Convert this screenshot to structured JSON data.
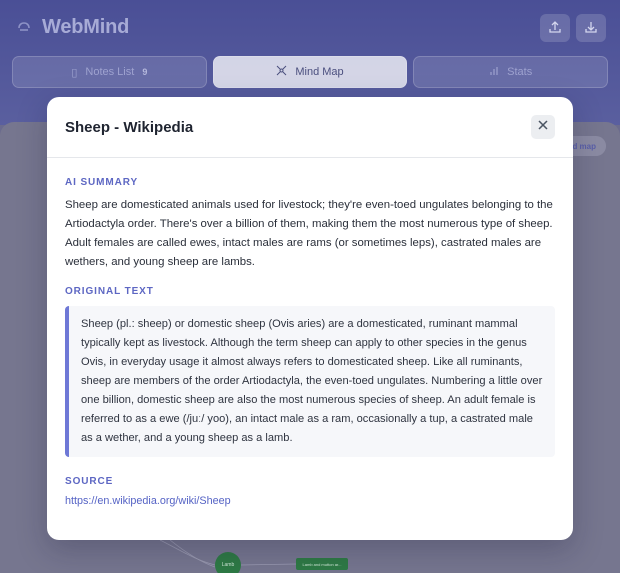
{
  "app": {
    "title": "WebMind"
  },
  "tabs": [
    {
      "label": "Notes List",
      "badge": "9",
      "icon": "notes-icon"
    },
    {
      "label": "Mind Map",
      "icon": "mind-map-icon"
    },
    {
      "label": "Stats",
      "icon": "bar-chart-icon"
    }
  ],
  "canvas": {
    "load_map_label": "d map",
    "node_circle_label": "Lamb",
    "node_box_label": "Lamb and mutton ar..."
  },
  "modal": {
    "title": "Sheep - Wikipedia",
    "summary_heading": "AI SUMMARY",
    "summary_text": "Sheep are domesticated animals used for livestock; they're even-toed ungulates belonging to the Artiodactyla order. There's over a billion of them, making them the most numerous type of sheep. Adult females are called ewes, intact males are rams (or sometimes leps), castrated males are wethers, and young sheep are lambs.",
    "original_heading": "ORIGINAL TEXT",
    "original_text": "Sheep (pl.: sheep) or domestic sheep (Ovis aries) are a domesticated, ruminant mammal typically kept as livestock. Although the term sheep can apply to other species in the genus Ovis, in everyday usage it almost always refers to domesticated sheep. Like all ruminants, sheep are members of the order Artiodactyla, the even-toed ungulates. Numbering a little over one billion, domestic sheep are also the most numerous species of sheep. An adult female is referred to as a ewe (/juː/ yoo), an intact male as a ram, occasionally a tup, a castrated male as a wether, and a young sheep as a lamb.",
    "source_heading": "SOURCE",
    "source_url": "https://en.wikipedia.org/wiki/Sheep"
  },
  "colors": {
    "accent": "#5d67c3",
    "header_gradient_top": "#4a4f96",
    "node_green": "#2e7a45"
  }
}
